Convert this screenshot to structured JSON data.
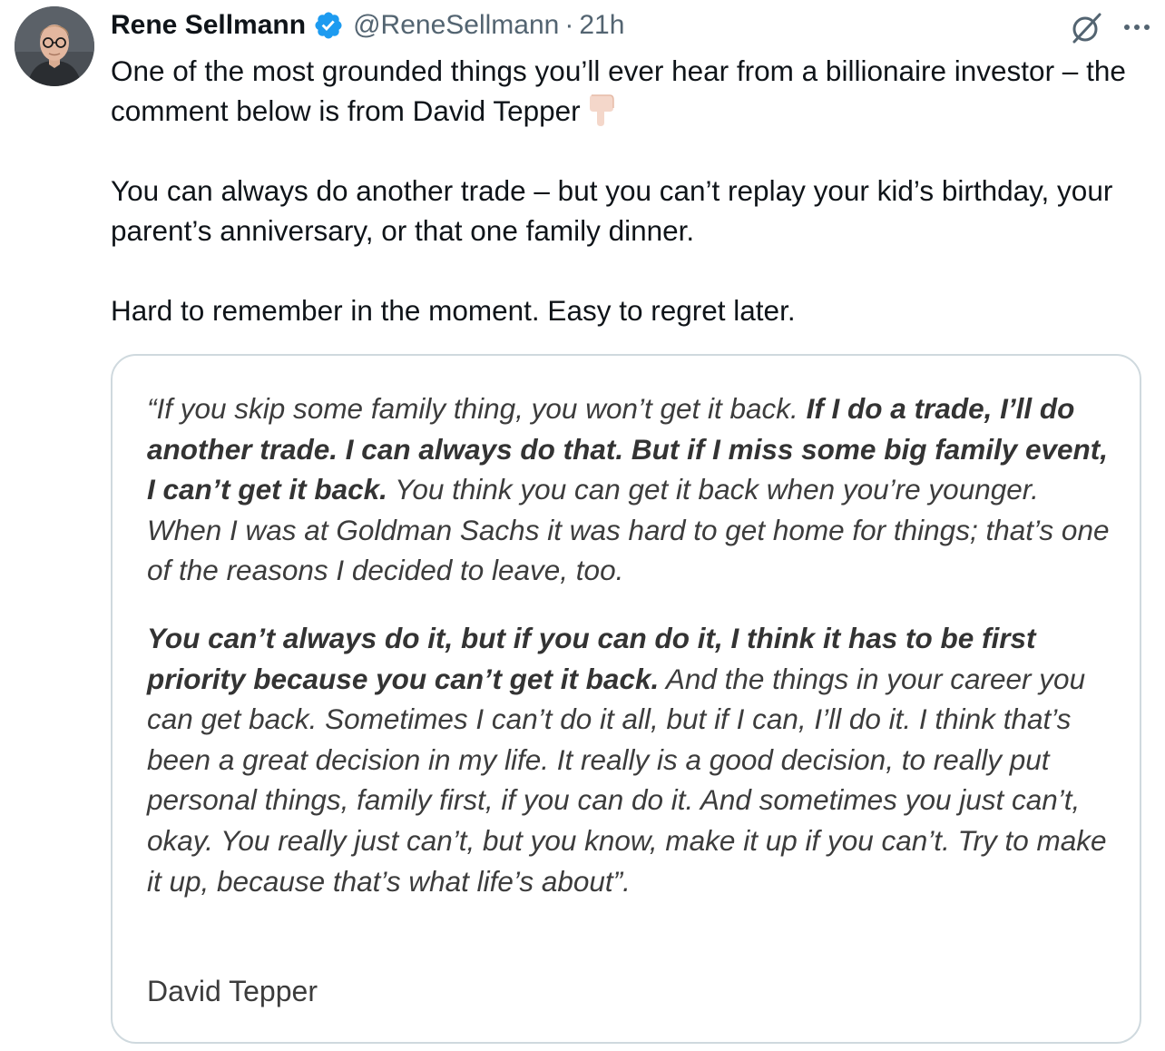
{
  "tweet": {
    "author": {
      "display_name": "Rene Sellmann",
      "handle": "@ReneSellmann",
      "verified": true,
      "verified_color": "#1d9bf0"
    },
    "separator": "·",
    "time": "21h",
    "text": {
      "line1": "One of the most grounded things you’ll ever hear from a billionaire investor – the comment below is from David Tepper",
      "emoji": "pointing-down-emoji",
      "para2": "You can always do another trade – but you can’t replay your kid’s birthday, your parent’s anniversary, or that one family dinner.",
      "para3": "Hard to remember in the moment. Easy to regret later."
    },
    "icons": {
      "grok": "grok-icon",
      "more": "more-icon"
    },
    "media": {
      "quote": {
        "p1_part1": "“If you skip some family thing, you won’t get it back. ",
        "p1_bold": "If I do a trade, I’ll do another trade. I can always do that. But if I miss some big family event, I can’t get it back.",
        "p1_part2": " You think you can get it back when you’re younger. When I was at Goldman Sachs it was hard to get home for things; that’s one of the reasons I decided to leave, too.",
        "p2_bold": "You can’t always do it, but if you can do it, I think it has to be first priority because you can’t get it back.",
        "p2_part2": " And the things in your career you can get back. Sometimes I can’t do it all, but if I can, I’ll do it. I think that’s been a great decision in my life. It really is a good decision, to really put personal things, family first, if you can do it. And sometimes you just can’t, okay. You really just can’t, but you know, make it up if you can’t. Try to make it up, because that’s what life’s about”."
      },
      "attribution": "David Tepper"
    }
  }
}
